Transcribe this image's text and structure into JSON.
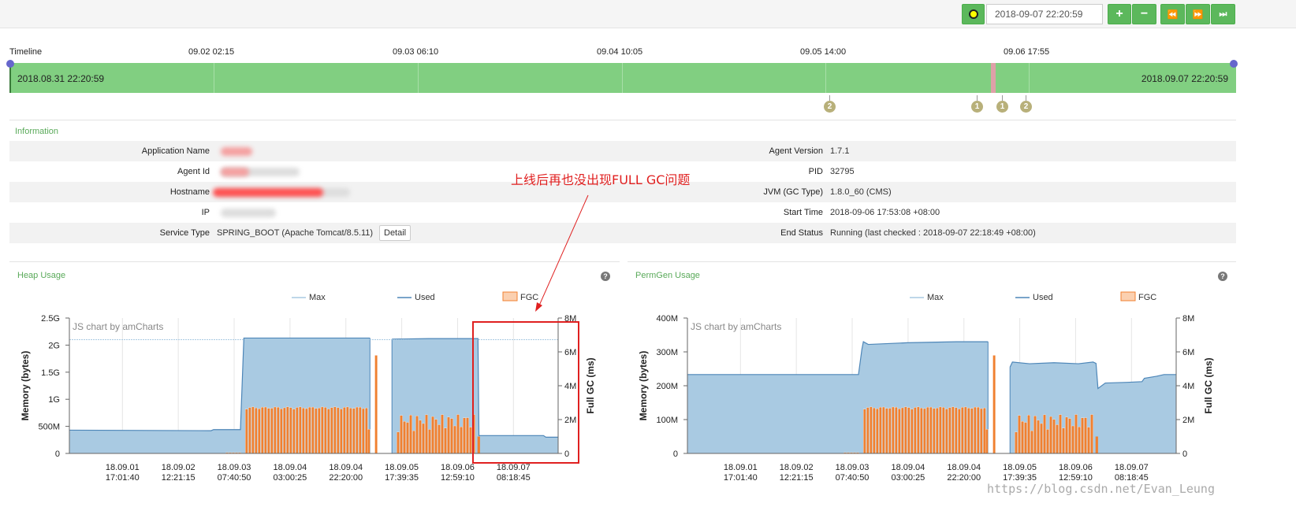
{
  "toolbar": {
    "date_value": "2018-09-07 22:20:59",
    "zoom_in": "+",
    "zoom_out": "−",
    "prev": "⏪",
    "next": "⏩",
    "last": "⏭"
  },
  "timeline": {
    "label": "Timeline",
    "ticks": [
      "09.02 02:15",
      "09.03 06:10",
      "09.04 10:05",
      "09.05 14:00",
      "09.06 17:55"
    ],
    "start": "2018.08.31 22:20:59",
    "end": "2018.09.07 22:20:59",
    "markers": [
      "2",
      "1",
      "1",
      "2"
    ]
  },
  "info": {
    "title": "Information",
    "left": [
      {
        "label": "Application Name",
        "value": ""
      },
      {
        "label": "Agent Id",
        "value": ""
      },
      {
        "label": "Hostname",
        "value": ""
      },
      {
        "label": "IP",
        "value": ""
      },
      {
        "label": "Service Type",
        "value": "SPRING_BOOT  (Apache Tomcat/8.5.11)"
      }
    ],
    "right": [
      {
        "label": "Agent Version",
        "value": "1.7.1"
      },
      {
        "label": "PID",
        "value": "32795"
      },
      {
        "label": "JVM (GC Type)",
        "value": "1.8.0_60 (CMS)"
      },
      {
        "label": "Start Time",
        "value": "2018-09-06 17:53:08 +08:00"
      },
      {
        "label": "End Status",
        "value": "Running (last checked : 2018-09-07 22:18:49 +08:00)"
      }
    ],
    "detail_button": "Detail"
  },
  "annotation": "上线后再也没出现FULL GC问题",
  "watermark": "https://blog.csdn.net/Evan_Leung",
  "colors": {
    "accent_green": "#5cb85c",
    "used_fill": "#a9cae2",
    "used_line": "#4d86b8",
    "fgc": "#f08030",
    "annotation_red": "#e02020"
  },
  "chart_data": [
    {
      "type": "area",
      "title": "Heap Usage",
      "credit": "JS chart by amCharts",
      "legend": [
        "Max",
        "Used",
        "FGC"
      ],
      "ylabel": "Memory (bytes)",
      "y2label": "Full GC (ms)",
      "yticks": [
        "2.5G",
        "2G",
        "1.5G",
        "1G",
        "500M",
        "0"
      ],
      "y2ticks": [
        "8M",
        "6M",
        "4M",
        "2M",
        "0"
      ],
      "xticks": [
        [
          "18.09.01",
          "17:01:40"
        ],
        [
          "18.09.02",
          "12:21:15"
        ],
        [
          "18.09.03",
          "07:40:50"
        ],
        [
          "18.09.04",
          "03:00:25"
        ],
        [
          "18.09.04",
          "22:20:00"
        ],
        [
          "18.09.05",
          "17:39:35"
        ],
        [
          "18.09.06",
          "12:59:10"
        ],
        [
          "18.09.07",
          "08:18:45"
        ]
      ],
      "ylim": [
        0,
        2.5
      ],
      "y2lim": [
        0,
        8
      ],
      "max_value": 2.1,
      "used_segments": [
        {
          "points": [
            [
              0,
              0.43
            ],
            [
              0.29,
              0.42
            ],
            [
              0.295,
              0.44
            ],
            [
              0.35,
              0.44
            ],
            [
              0.357,
              2.13
            ],
            [
              0.615,
              2.13
            ]
          ]
        },
        {
          "points": [
            [
              0.66,
              2.11
            ],
            [
              0.735,
              2.12
            ],
            [
              0.836,
              2.12
            ],
            [
              0.838,
              0.33
            ],
            [
              0.97,
              0.33
            ],
            [
              0.975,
              0.3
            ],
            [
              1.0,
              0.3
            ]
          ]
        }
      ],
      "fgc_bands": [
        {
          "from": 0.32,
          "to": 0.35,
          "level": 0.05
        },
        {
          "from": 0.36,
          "to": 0.61,
          "level": 2.75
        },
        {
          "from": 0.61,
          "to": 0.615,
          "level": 1.5
        },
        {
          "from": 0.625,
          "to": 0.63,
          "level": 6.1
        },
        {
          "from": 0.67,
          "to": 0.83,
          "level": 2.3
        }
      ],
      "fgc_tail": {
        "from": 0.835,
        "to": 0.84,
        "level": 1.0
      }
    },
    {
      "type": "area",
      "title": "PermGen Usage",
      "credit": "JS chart by amCharts",
      "legend": [
        "Max",
        "Used",
        "FGC"
      ],
      "ylabel": "Memory (bytes)",
      "y2label": "Full GC (ms)",
      "yticks": [
        "400M",
        "300M",
        "200M",
        "100M",
        "0"
      ],
      "y2ticks": [
        "8M",
        "6M",
        "4M",
        "2M",
        "0"
      ],
      "xticks": [
        [
          "18.09.01",
          "17:01:40"
        ],
        [
          "18.09.02",
          "12:21:15"
        ],
        [
          "18.09.03",
          "07:40:50"
        ],
        [
          "18.09.04",
          "03:00:25"
        ],
        [
          "18.09.04",
          "22:20:00"
        ],
        [
          "18.09.05",
          "17:39:35"
        ],
        [
          "18.09.06",
          "12:59:10"
        ],
        [
          "18.09.07",
          "08:18:45"
        ]
      ],
      "ylim": [
        0,
        400
      ],
      "y2lim": [
        0,
        8
      ],
      "used_segments": [
        {
          "points": [
            [
              0,
              233
            ],
            [
              0.35,
              233
            ],
            [
              0.357,
              308
            ],
            [
              0.36,
              330
            ],
            [
              0.37,
              322
            ],
            [
              0.45,
              327
            ],
            [
              0.55,
              330
            ],
            [
              0.6,
              330
            ],
            [
              0.615,
              330
            ]
          ]
        },
        {
          "points": [
            [
              0.66,
              255
            ],
            [
              0.665,
              270
            ],
            [
              0.7,
              265
            ],
            [
              0.75,
              268
            ],
            [
              0.8,
              265
            ],
            [
              0.83,
              270
            ],
            [
              0.836,
              266
            ],
            [
              0.84,
              192
            ],
            [
              0.855,
              208
            ],
            [
              0.9,
              210
            ],
            [
              0.93,
              212
            ],
            [
              0.935,
              222
            ],
            [
              0.96,
              228
            ],
            [
              0.975,
              233
            ],
            [
              1.0,
              233
            ]
          ]
        }
      ],
      "fgc_bands": [
        {
          "from": 0.32,
          "to": 0.35,
          "level": 0.05
        },
        {
          "from": 0.36,
          "to": 0.61,
          "level": 2.75
        },
        {
          "from": 0.61,
          "to": 0.615,
          "level": 1.5
        },
        {
          "from": 0.625,
          "to": 0.63,
          "level": 6.1
        },
        {
          "from": 0.67,
          "to": 0.83,
          "level": 2.3
        }
      ],
      "fgc_tail": {
        "from": 0.835,
        "to": 0.84,
        "level": 1.0
      }
    }
  ]
}
